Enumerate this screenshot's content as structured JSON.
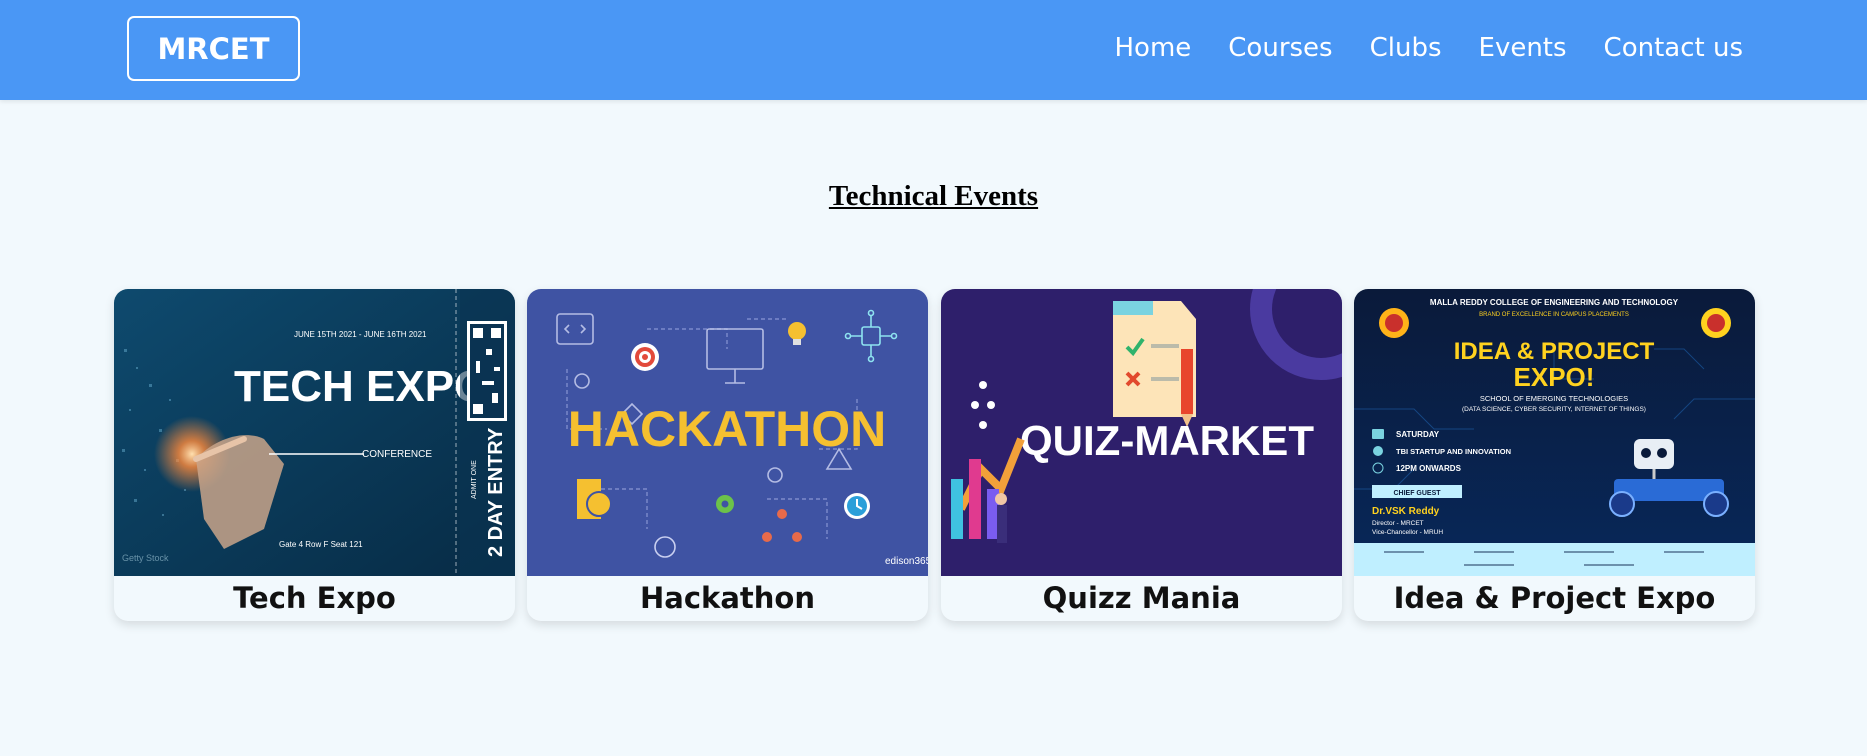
{
  "header": {
    "brand": "MRCET",
    "nav": [
      "Home",
      "Courses",
      "Clubs",
      "Events",
      "Contact us"
    ]
  },
  "page": {
    "section_title": "Technical Events"
  },
  "events": [
    {
      "title": "Tech Expo",
      "image_text": {
        "headline": "TECH EXPO",
        "sub": "CONFERENCE",
        "dates": "JUNE 15TH 2021 - JUNE 16TH 2021",
        "ticket": "2 DAY ENTRY",
        "admit": "ADMIT ONE",
        "gate": "Gate 4  Row F  Seat 121",
        "credit": "Getty Stock"
      }
    },
    {
      "title": "Hackathon",
      "image_text": {
        "headline": "HACKATHON",
        "credit": "edison365"
      }
    },
    {
      "title": "Quizz Mania",
      "image_text": {
        "headline": "QUIZ-MARKET"
      }
    },
    {
      "title": "Idea & Project Expo",
      "image_text": {
        "college": "MALLA REDDY COLLEGE OF ENGINEERING AND TECHNOLOGY",
        "tagline": "BRAND OF EXCELLENCE IN CAMPUS PLACEMENTS",
        "headline1": "IDEA & PROJECT",
        "headline2": "EXPO!",
        "school": "SCHOOL OF EMERGING TECHNOLOGIES",
        "school_sub": "(DATA SCIENCE, CYBER SECURITY, INTERNET OF THINGS)",
        "day": "SATURDAY",
        "venue": "TBI STARTUP AND INNOVATION",
        "time": "12PM ONWARDS",
        "guest_label": "CHIEF GUEST",
        "guest_name": "Dr.VSK Reddy",
        "guest_role1": "Director - MRCET",
        "guest_role2": "Vice-Chancellor - MRUH"
      }
    }
  ],
  "colors": {
    "nav_bg": "#4a97f5",
    "page_bg": "#f2f9fd",
    "hackathon_bg": "#3f53a3",
    "hackathon_text": "#f5c030",
    "quiz_bg": "#2e1f6b",
    "techexpo_bg": "#0c3a5c",
    "expo_yellow": "#ffd21f"
  }
}
